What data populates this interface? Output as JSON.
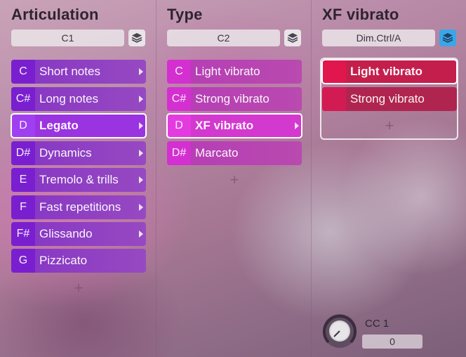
{
  "columns": {
    "articulation": {
      "title": "Articulation",
      "selector": "C1",
      "items": [
        {
          "key": "C",
          "label": "Short notes",
          "submenu": true
        },
        {
          "key": "C#",
          "label": "Long notes",
          "submenu": true
        },
        {
          "key": "D",
          "label": "Legato",
          "submenu": true,
          "selected": true
        },
        {
          "key": "D#",
          "label": "Dynamics",
          "submenu": true
        },
        {
          "key": "E",
          "label": "Tremolo & trills",
          "submenu": true
        },
        {
          "key": "F",
          "label": "Fast repetitions",
          "submenu": true
        },
        {
          "key": "F#",
          "label": "Glissando",
          "submenu": true
        },
        {
          "key": "G",
          "label": "Pizzicato",
          "submenu": false
        }
      ],
      "add_label": "+"
    },
    "type": {
      "title": "Type",
      "selector": "C2",
      "items": [
        {
          "key": "C",
          "label": "Light vibrato",
          "submenu": false
        },
        {
          "key": "C#",
          "label": "Strong vibrato",
          "submenu": false
        },
        {
          "key": "D",
          "label": "XF vibrato",
          "submenu": true,
          "selected": true
        },
        {
          "key": "D#",
          "label": "Marcato",
          "submenu": false
        }
      ],
      "add_label": "+"
    },
    "xf_vibrato": {
      "title": "XF vibrato",
      "selector": "Dim.Ctrl/A",
      "items": [
        {
          "key": "",
          "label": "Light vibrato",
          "selected": true
        },
        {
          "key": "",
          "label": "Strong vibrato"
        }
      ],
      "add_label": "+",
      "controller": {
        "label": "CC 1",
        "value": "0"
      }
    }
  },
  "icons": {
    "layers": "layers-icon",
    "submenu": "chevron-right-icon",
    "add": "plus-icon",
    "knob": "knob-icon"
  },
  "colors": {
    "articulation_key": "#7a1fcf",
    "type_key": "#d42fd0",
    "xf_key": "#d21b52",
    "layers_active": "#3aa6e6"
  }
}
